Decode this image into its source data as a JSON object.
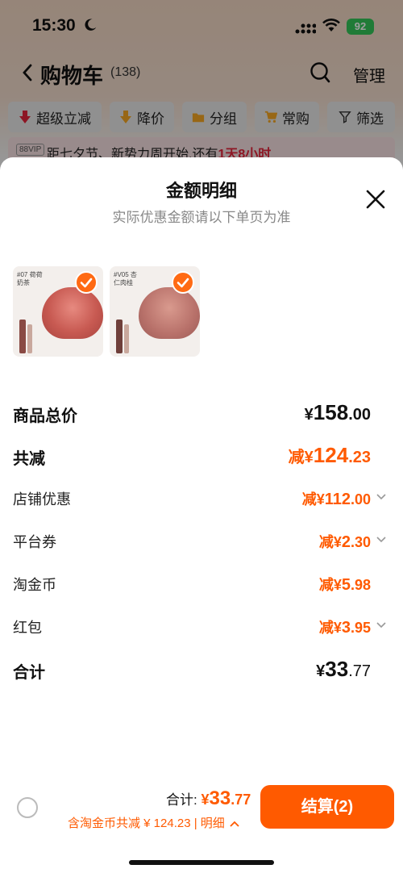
{
  "status_bar": {
    "time": "15:30",
    "battery": "92"
  },
  "nav": {
    "title": "购物车",
    "count": "(138)",
    "manage": "管理"
  },
  "filters": [
    "超级立减",
    "降价",
    "分组",
    "常购",
    "筛选"
  ],
  "promo": {
    "badge": "88VIP",
    "text": "距七夕节、新势力周开始,还有",
    "highlight": "1天8小时"
  },
  "sheet": {
    "title": "金额明细",
    "subtitle": "实际优惠金额请以下单页为准",
    "products": [
      {
        "label": "#07 荷荷奶茶"
      },
      {
        "label": "#V05 杏仁肉桂"
      }
    ],
    "rows": [
      {
        "label": "商品总价",
        "currency": "¥",
        "int": "158",
        "dec": ".00"
      },
      {
        "label": "共减",
        "prefix": "减",
        "currency": "¥",
        "int": "124",
        "dec": ".23"
      },
      {
        "label": "店铺优惠",
        "prefix": "减",
        "currency": "¥",
        "int": "112",
        "dec": ".00"
      },
      {
        "label": "平台券",
        "prefix": "减",
        "currency": "¥",
        "int": "2",
        "dec": ".30"
      },
      {
        "label": "淘金币",
        "prefix": "减",
        "currency": "¥",
        "int": "5",
        "dec": ".98"
      },
      {
        "label": "红包",
        "prefix": "减",
        "currency": "¥",
        "int": "3",
        "dec": ".95"
      },
      {
        "label": "合计",
        "currency": "¥",
        "int": "33",
        "dec": ".77"
      }
    ]
  },
  "bottom": {
    "total_label": "合计:",
    "total_currency": "¥",
    "total_int": "33",
    "total_dec": ".77",
    "sub_text": "含淘金币共减 ¥ 124.23 | 明细",
    "checkout": "结算(2)"
  },
  "colors": {
    "accent": "#ff5a00",
    "check": "#ff6a13"
  }
}
